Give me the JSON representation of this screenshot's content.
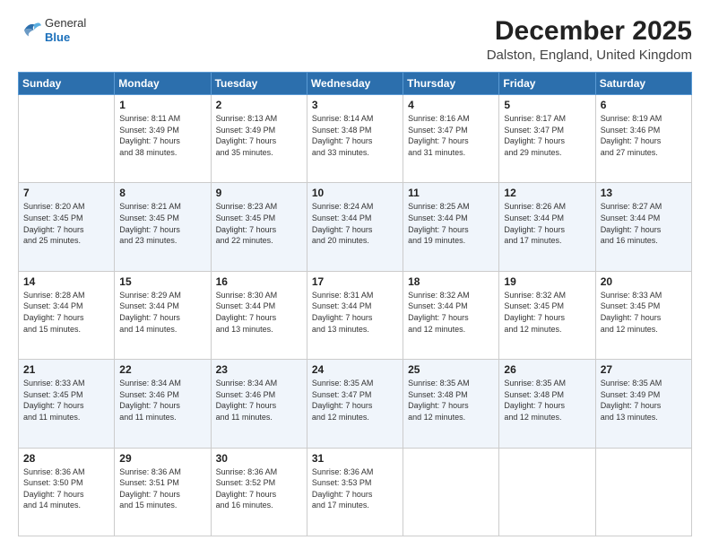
{
  "header": {
    "logo": {
      "general": "General",
      "blue": "Blue"
    },
    "title": "December 2025",
    "subtitle": "Dalston, England, United Kingdom"
  },
  "calendar": {
    "headers": [
      "Sunday",
      "Monday",
      "Tuesday",
      "Wednesday",
      "Thursday",
      "Friday",
      "Saturday"
    ],
    "weeks": [
      [
        {
          "day": "",
          "info": ""
        },
        {
          "day": "1",
          "info": "Sunrise: 8:11 AM\nSunset: 3:49 PM\nDaylight: 7 hours\nand 38 minutes."
        },
        {
          "day": "2",
          "info": "Sunrise: 8:13 AM\nSunset: 3:49 PM\nDaylight: 7 hours\nand 35 minutes."
        },
        {
          "day": "3",
          "info": "Sunrise: 8:14 AM\nSunset: 3:48 PM\nDaylight: 7 hours\nand 33 minutes."
        },
        {
          "day": "4",
          "info": "Sunrise: 8:16 AM\nSunset: 3:47 PM\nDaylight: 7 hours\nand 31 minutes."
        },
        {
          "day": "5",
          "info": "Sunrise: 8:17 AM\nSunset: 3:47 PM\nDaylight: 7 hours\nand 29 minutes."
        },
        {
          "day": "6",
          "info": "Sunrise: 8:19 AM\nSunset: 3:46 PM\nDaylight: 7 hours\nand 27 minutes."
        }
      ],
      [
        {
          "day": "7",
          "info": "Sunrise: 8:20 AM\nSunset: 3:45 PM\nDaylight: 7 hours\nand 25 minutes."
        },
        {
          "day": "8",
          "info": "Sunrise: 8:21 AM\nSunset: 3:45 PM\nDaylight: 7 hours\nand 23 minutes."
        },
        {
          "day": "9",
          "info": "Sunrise: 8:23 AM\nSunset: 3:45 PM\nDaylight: 7 hours\nand 22 minutes."
        },
        {
          "day": "10",
          "info": "Sunrise: 8:24 AM\nSunset: 3:44 PM\nDaylight: 7 hours\nand 20 minutes."
        },
        {
          "day": "11",
          "info": "Sunrise: 8:25 AM\nSunset: 3:44 PM\nDaylight: 7 hours\nand 19 minutes."
        },
        {
          "day": "12",
          "info": "Sunrise: 8:26 AM\nSunset: 3:44 PM\nDaylight: 7 hours\nand 17 minutes."
        },
        {
          "day": "13",
          "info": "Sunrise: 8:27 AM\nSunset: 3:44 PM\nDaylight: 7 hours\nand 16 minutes."
        }
      ],
      [
        {
          "day": "14",
          "info": "Sunrise: 8:28 AM\nSunset: 3:44 PM\nDaylight: 7 hours\nand 15 minutes."
        },
        {
          "day": "15",
          "info": "Sunrise: 8:29 AM\nSunset: 3:44 PM\nDaylight: 7 hours\nand 14 minutes."
        },
        {
          "day": "16",
          "info": "Sunrise: 8:30 AM\nSunset: 3:44 PM\nDaylight: 7 hours\nand 13 minutes."
        },
        {
          "day": "17",
          "info": "Sunrise: 8:31 AM\nSunset: 3:44 PM\nDaylight: 7 hours\nand 13 minutes."
        },
        {
          "day": "18",
          "info": "Sunrise: 8:32 AM\nSunset: 3:44 PM\nDaylight: 7 hours\nand 12 minutes."
        },
        {
          "day": "19",
          "info": "Sunrise: 8:32 AM\nSunset: 3:45 PM\nDaylight: 7 hours\nand 12 minutes."
        },
        {
          "day": "20",
          "info": "Sunrise: 8:33 AM\nSunset: 3:45 PM\nDaylight: 7 hours\nand 12 minutes."
        }
      ],
      [
        {
          "day": "21",
          "info": "Sunrise: 8:33 AM\nSunset: 3:45 PM\nDaylight: 7 hours\nand 11 minutes."
        },
        {
          "day": "22",
          "info": "Sunrise: 8:34 AM\nSunset: 3:46 PM\nDaylight: 7 hours\nand 11 minutes."
        },
        {
          "day": "23",
          "info": "Sunrise: 8:34 AM\nSunset: 3:46 PM\nDaylight: 7 hours\nand 11 minutes."
        },
        {
          "day": "24",
          "info": "Sunrise: 8:35 AM\nSunset: 3:47 PM\nDaylight: 7 hours\nand 12 minutes."
        },
        {
          "day": "25",
          "info": "Sunrise: 8:35 AM\nSunset: 3:48 PM\nDaylight: 7 hours\nand 12 minutes."
        },
        {
          "day": "26",
          "info": "Sunrise: 8:35 AM\nSunset: 3:48 PM\nDaylight: 7 hours\nand 12 minutes."
        },
        {
          "day": "27",
          "info": "Sunrise: 8:35 AM\nSunset: 3:49 PM\nDaylight: 7 hours\nand 13 minutes."
        }
      ],
      [
        {
          "day": "28",
          "info": "Sunrise: 8:36 AM\nSunset: 3:50 PM\nDaylight: 7 hours\nand 14 minutes."
        },
        {
          "day": "29",
          "info": "Sunrise: 8:36 AM\nSunset: 3:51 PM\nDaylight: 7 hours\nand 15 minutes."
        },
        {
          "day": "30",
          "info": "Sunrise: 8:36 AM\nSunset: 3:52 PM\nDaylight: 7 hours\nand 16 minutes."
        },
        {
          "day": "31",
          "info": "Sunrise: 8:36 AM\nSunset: 3:53 PM\nDaylight: 7 hours\nand 17 minutes."
        },
        {
          "day": "",
          "info": ""
        },
        {
          "day": "",
          "info": ""
        },
        {
          "day": "",
          "info": ""
        }
      ]
    ]
  }
}
